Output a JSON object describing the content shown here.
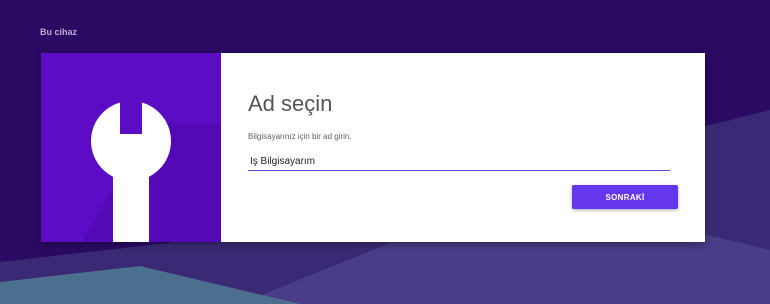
{
  "header": {
    "device_label": "Bu cihaz"
  },
  "card": {
    "icon": "wrench-icon",
    "title": "Ad seçin",
    "subtitle": "Bilgisayarınız için bir ad girin.",
    "name_input": {
      "value": "İş Bilgisayarım",
      "placeholder": ""
    },
    "next_label": "SONRAKİ"
  },
  "colors": {
    "background": "#2a0a63",
    "card_left": "#5b0cc4",
    "accent": "#6436ee"
  }
}
